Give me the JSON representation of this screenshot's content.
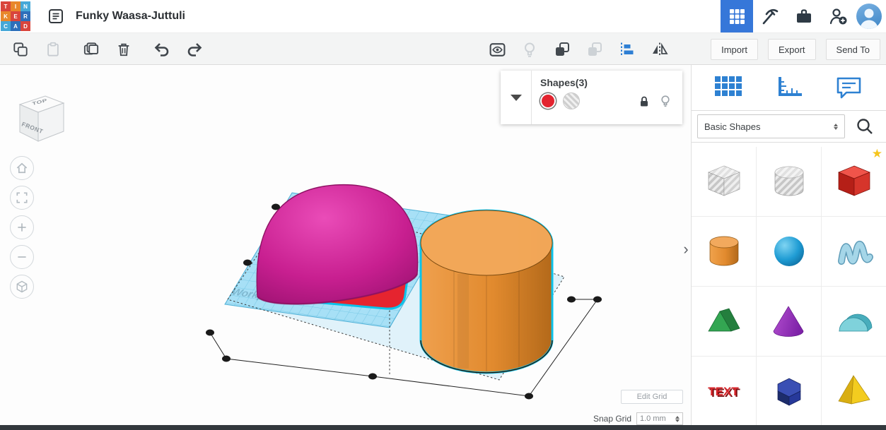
{
  "app": {
    "title": "Funky Waasa-Juttuli"
  },
  "topbar": {
    "logo_letters": [
      "T",
      "I",
      "N",
      "K",
      "E",
      "R",
      "C",
      "A",
      "D"
    ],
    "icon_names": [
      "document-list-icon",
      "apps-grid-icon",
      "pickaxe-icon",
      "briefcase-icon",
      "person-add-icon",
      "avatar"
    ]
  },
  "toolbar": {
    "import": "Import",
    "export": "Export",
    "send_to": "Send To",
    "icon_names": [
      "copy-icon",
      "paste-icon",
      "duplicate-icon",
      "delete-icon",
      "undo-icon",
      "redo-icon",
      "show-hidden-icon",
      "lights-icon",
      "group-icon",
      "ungroup-icon",
      "align-icon",
      "mirror-icon"
    ]
  },
  "selection_panel": {
    "title": "Shapes(3)",
    "color_swatch": "#e3232f",
    "icon_names": [
      "caret-down-icon",
      "color-swatch-red",
      "hole-material-swatch",
      "lock-icon",
      "lightbulb-icon"
    ]
  },
  "viewport": {
    "view_cube": {
      "top": "TOP",
      "front": "FRONT"
    },
    "nav_icon_names": [
      "home-icon",
      "fit-view-icon",
      "zoom-in-icon",
      "zoom-out-icon",
      "perspective-icon"
    ],
    "workplane_watermark": "Workplane",
    "edit_grid": "Edit Grid",
    "snap_grid_label": "Snap Grid",
    "snap_grid_value": "1.0 mm",
    "collapse_chevron": "›"
  },
  "right_panel": {
    "tab_icon_names": [
      "workplane-grid-icon",
      "ruler-icon",
      "notes-icon"
    ],
    "category_dropdown": "Basic Shapes",
    "search_icon": "magnifier-icon",
    "star_glyph": "★",
    "tiles": [
      {
        "name": "box-hole"
      },
      {
        "name": "cylinder-hole"
      },
      {
        "name": "box",
        "starred": true
      },
      {
        "name": "cylinder"
      },
      {
        "name": "sphere"
      },
      {
        "name": "scribble"
      },
      {
        "name": "roof"
      },
      {
        "name": "cone"
      },
      {
        "name": "round-roof"
      },
      {
        "name": "text",
        "label": "TEXT"
      },
      {
        "name": "polygon"
      },
      {
        "name": "pyramid"
      }
    ]
  },
  "scene": {
    "colors": {
      "workplane": "#a7e0f6",
      "workplane_line": "#74c6e4",
      "selection": "#0bc2ea",
      "dome": "#cb2492",
      "base": "#e5242f",
      "cylinder": "#e28a30"
    }
  }
}
